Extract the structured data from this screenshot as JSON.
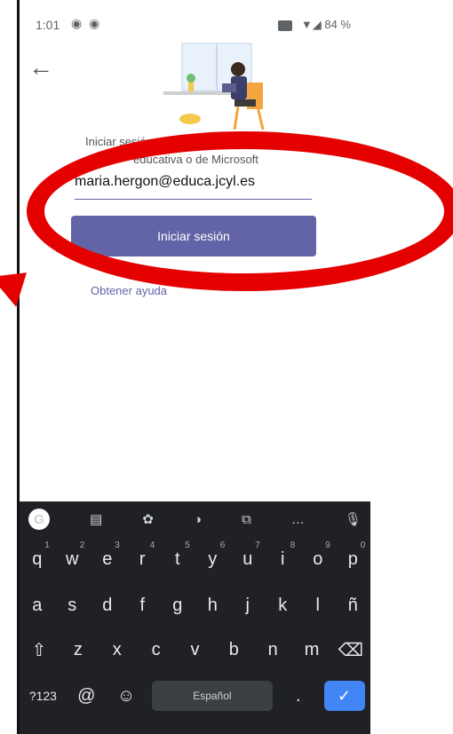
{
  "status_bar": {
    "time": "1:01",
    "icons": "◉ ◉",
    "battery": "84 %"
  },
  "back_icon": "←",
  "signin": {
    "prompt_line1": "Iniciar sesión",
    "prompt_line2": "educativa o de Microsoft",
    "email_value": "maria.hergon@educa.jcyl.es",
    "button_label": "Iniciar sesión",
    "help_link": "Obtener ayuda"
  },
  "keyboard": {
    "toolbar_icons": [
      "G",
      "▤",
      "✿",
      "◑",
      "⧉",
      "…",
      "🎙"
    ],
    "row1": [
      {
        "k": "q",
        "h": "1"
      },
      {
        "k": "w",
        "h": "2"
      },
      {
        "k": "e",
        "h": "3"
      },
      {
        "k": "r",
        "h": "4"
      },
      {
        "k": "t",
        "h": "5"
      },
      {
        "k": "y",
        "h": "6"
      },
      {
        "k": "u",
        "h": "7"
      },
      {
        "k": "i",
        "h": "8"
      },
      {
        "k": "o",
        "h": "9"
      },
      {
        "k": "p",
        "h": "0"
      }
    ],
    "row2": [
      "a",
      "s",
      "d",
      "f",
      "g",
      "h",
      "j",
      "k",
      "l",
      "ñ"
    ],
    "row3": [
      "⇧",
      "z",
      "x",
      "c",
      "v",
      "b",
      "n",
      "m",
      "⌫"
    ],
    "row4": {
      "sym": "?123",
      "at": "@",
      "emoji": "☺",
      "space": "Español",
      "dot": ".",
      "enter": "✓"
    }
  },
  "annotation_color": "#e50000"
}
